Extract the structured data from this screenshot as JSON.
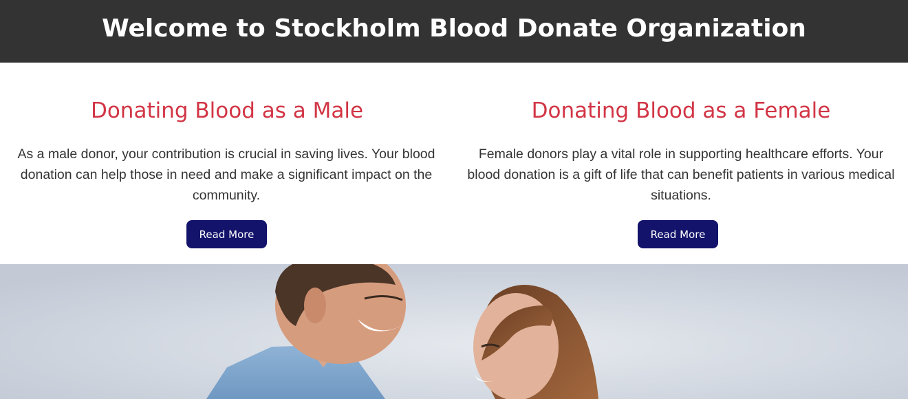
{
  "header": {
    "title": "Welcome to Stockholm Blood Donate Organization"
  },
  "cards": [
    {
      "title": "Donating Blood as a Male",
      "text": "As a male donor, your contribution is crucial in saving lives. Your blood donation can help those in need and make a significant impact on the community.",
      "button_label": "Read More"
    },
    {
      "title": "Donating Blood as a Female",
      "text": "Female donors play a vital role in supporting healthcare efforts. Your blood donation is a gift of life that can benefit patients in various medical situations.",
      "button_label": "Read More"
    }
  ],
  "colors": {
    "header_bg": "#333333",
    "title_red": "#d23545",
    "button_navy": "#13136b"
  }
}
